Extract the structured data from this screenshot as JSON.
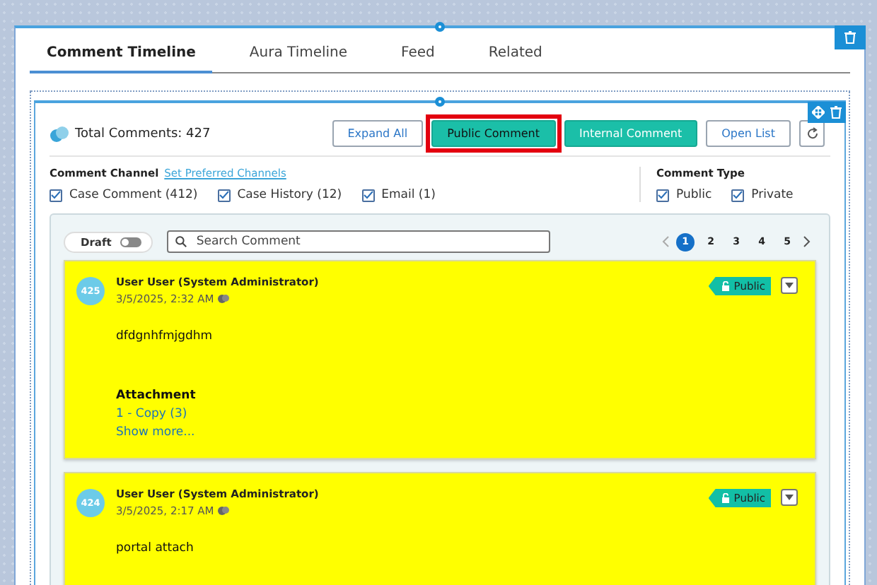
{
  "tabs": [
    {
      "label": "Comment Timeline",
      "selected": true
    },
    {
      "label": "Aura Timeline",
      "selected": false
    },
    {
      "label": "Feed",
      "selected": false
    },
    {
      "label": "Related",
      "selected": false
    }
  ],
  "total_comments": "Total Comments: 427",
  "actions": [
    {
      "label": "Expand All",
      "kind": "outline",
      "highlighted": false
    },
    {
      "label": "Public Comment",
      "kind": "primary",
      "highlighted": true
    },
    {
      "label": "Internal Comment",
      "kind": "primary",
      "highlighted": false
    },
    {
      "label": "Open List",
      "kind": "outline",
      "highlighted": false
    },
    {
      "kind": "refresh",
      "highlighted": false
    }
  ],
  "comment_channel": {
    "title": "Comment Channel",
    "link": "Set Preferred Channels",
    "options": [
      {
        "label": "Case Comment (412)",
        "checked": true
      },
      {
        "label": "Case History (12)",
        "checked": true
      },
      {
        "label": "Email (1)",
        "checked": true
      }
    ]
  },
  "comment_type": {
    "title": "Comment Type",
    "options": [
      {
        "label": "Public",
        "checked": true
      },
      {
        "label": "Private",
        "checked": true
      }
    ]
  },
  "draft": {
    "label": "Draft",
    "on": false
  },
  "search": {
    "placeholder": "Search Comment"
  },
  "pages": [
    {
      "label": "1",
      "selected": true
    },
    {
      "label": "2",
      "selected": false
    },
    {
      "label": "3",
      "selected": false
    },
    {
      "label": "4",
      "selected": false
    },
    {
      "label": "5",
      "selected": false
    }
  ],
  "comments": [
    {
      "number": "425",
      "author": "User User (System Administrator)",
      "time": "3/5/2025, 2:32 AM",
      "visibility": "Public",
      "body": "dfdgnhfmjgdhm",
      "attachment": {
        "title": "Attachment",
        "files": [
          "1 - Copy (3)"
        ],
        "more": "Show more..."
      }
    },
    {
      "number": "424",
      "author": "User User (System Administrator)",
      "time": "3/5/2025, 2:17 AM",
      "visibility": "Public",
      "body": "portal attach"
    }
  ]
}
